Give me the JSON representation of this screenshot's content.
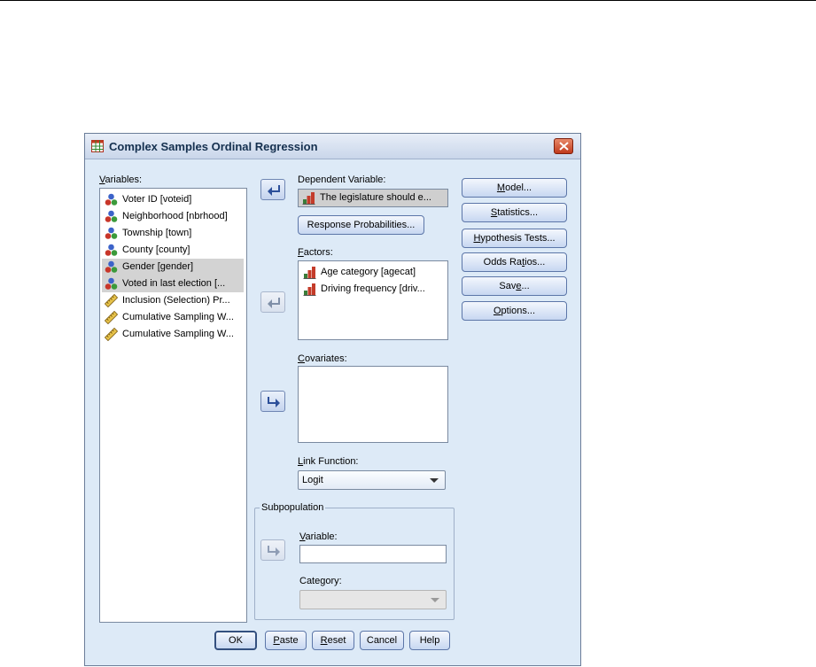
{
  "dialog": {
    "title": "Complex Samples Ordinal Regression",
    "variables_label": "Variables:",
    "variables_mnemonic": "V",
    "variables_rest": "ariables:",
    "variables": [
      {
        "label": "Voter ID [voteid]",
        "icon": "nominal-icon",
        "selected": false
      },
      {
        "label": "Neighborhood [nbrhood]",
        "icon": "nominal-icon",
        "selected": false
      },
      {
        "label": "Township [town]",
        "icon": "nominal-icon",
        "selected": false
      },
      {
        "label": "County [county]",
        "icon": "nominal-icon",
        "selected": false
      },
      {
        "label": "Gender [gender]",
        "icon": "nominal-icon",
        "selected": true
      },
      {
        "label": "Voted in last election [...",
        "icon": "nominal-icon",
        "selected": true
      },
      {
        "label": "Inclusion (Selection) Pr...",
        "icon": "scale-icon",
        "selected": false
      },
      {
        "label": "Cumulative Sampling W...",
        "icon": "scale-icon",
        "selected": false
      },
      {
        "label": "Cumulative Sampling W...",
        "icon": "scale-icon",
        "selected": false
      }
    ],
    "dependent": {
      "label": "Dependent Variable:",
      "value": "The legislature should e...",
      "response_button": "Response Probabilities..."
    },
    "factors": {
      "label_mnemonic": "F",
      "label_rest": "actors:",
      "items": [
        {
          "label": "Age category [agecat]",
          "icon": "ordinal-icon"
        },
        {
          "label": "Driving frequency [driv...",
          "icon": "ordinal-icon"
        }
      ]
    },
    "covariates": {
      "label_mnemonic": "C",
      "label_rest": "ovariates:"
    },
    "link_function": {
      "label_mnemonic": "L",
      "label_rest": "ink Function:",
      "value": "Logit"
    },
    "subpopulation": {
      "title": "Subpopulation",
      "variable_mnemonic": "V",
      "variable_rest": "ariable:",
      "variable_value": "",
      "category_pre": "Cate",
      "category_mnemonic": "g",
      "category_post": "ory:",
      "category_value": ""
    },
    "side_buttons": {
      "model": {
        "mn": "M",
        "rest": "odel..."
      },
      "statistics": {
        "mn": "S",
        "rest": "tatistics..."
      },
      "hypothesis": {
        "mn": "H",
        "rest": "ypothesis Tests..."
      },
      "odds_pre": "Odds Ra",
      "odds_mn": "t",
      "odds_post": "ios...",
      "save_pre": "Sav",
      "save_mn": "e",
      "save_post": "...",
      "options": {
        "mn": "O",
        "rest": "ptions..."
      }
    },
    "bottom_buttons": {
      "ok": "OK",
      "paste_mn": "P",
      "paste_rest": "aste",
      "reset_mn": "R",
      "reset_rest": "eset",
      "cancel": "Cancel",
      "help": "Help"
    }
  }
}
